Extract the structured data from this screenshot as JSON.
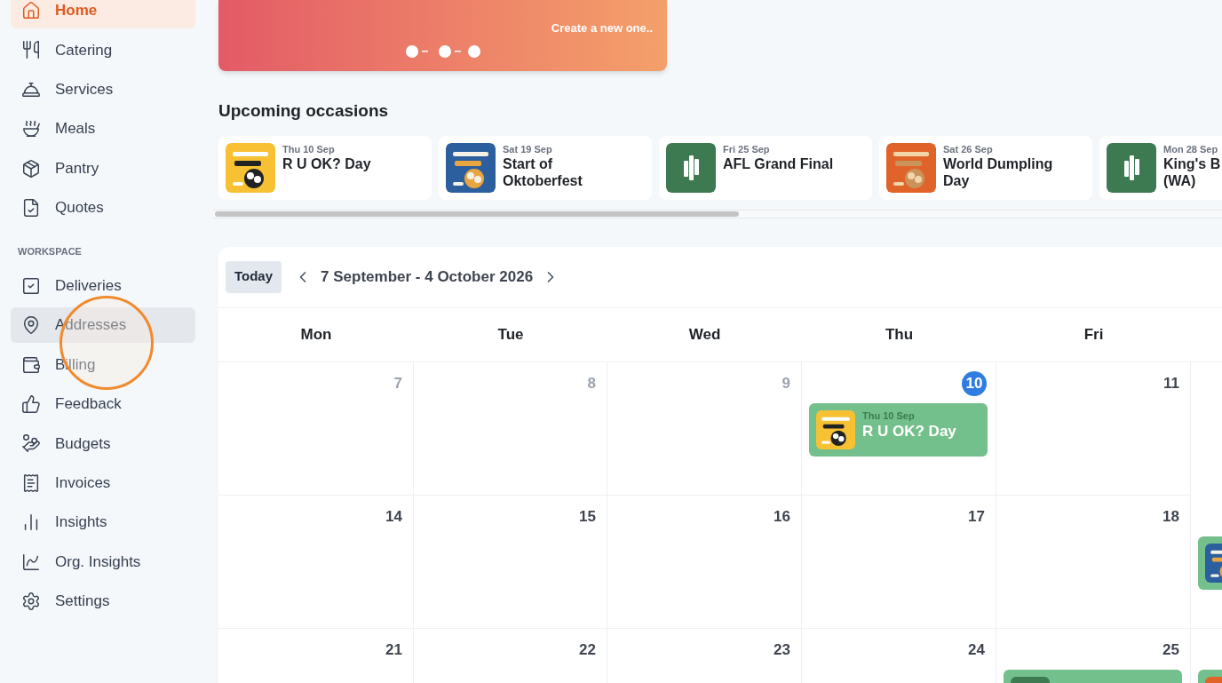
{
  "sidebar": {
    "sections": [
      {
        "items": [
          {
            "label": "Home",
            "selected": true,
            "hovered": false
          },
          {
            "label": "Catering",
            "selected": false,
            "hovered": false
          },
          {
            "label": "Services",
            "selected": false,
            "hovered": false
          },
          {
            "label": "Meals",
            "selected": false,
            "hovered": false
          },
          {
            "label": "Pantry",
            "selected": false,
            "hovered": false
          },
          {
            "label": "Quotes",
            "selected": false,
            "hovered": false
          }
        ]
      },
      {
        "heading": "WORKSPACE",
        "items": [
          {
            "label": "Deliveries",
            "selected": false,
            "hovered": false
          },
          {
            "label": "Addresses",
            "selected": false,
            "hovered": true
          },
          {
            "label": "Billing",
            "selected": false,
            "hovered": false
          },
          {
            "label": "Feedback",
            "selected": false,
            "hovered": false
          },
          {
            "label": "Budgets",
            "selected": false,
            "hovered": false
          },
          {
            "label": "Invoices",
            "selected": false,
            "hovered": false
          },
          {
            "label": "Insights",
            "selected": false,
            "hovered": false
          },
          {
            "label": "Org. Insights",
            "selected": false,
            "hovered": false
          },
          {
            "label": "Settings",
            "selected": false,
            "hovered": false
          }
        ]
      }
    ]
  },
  "banner": {
    "link": "Create a new one.."
  },
  "occasions": {
    "title": "Upcoming occasions",
    "items": [
      {
        "date": "Thu 10 Sep",
        "title": "R U OK? Day",
        "kind": "picture"
      },
      {
        "date": "Sat 19 Sep",
        "title": "Start of Oktoberfest",
        "kind": "picture"
      },
      {
        "date": "Fri 25 Sep",
        "title": "AFL Grand Final",
        "kind": "logo"
      },
      {
        "date": "Sat 26 Sep",
        "title": "World Dumpling Day",
        "kind": "picture"
      },
      {
        "date": "Mon 28 Sep",
        "title": "King's B\n(WA)",
        "kind": "logo"
      }
    ]
  },
  "calendar": {
    "today_button": "Today",
    "range": "7 September - 4 October 2026",
    "weekdays": [
      "Mon",
      "Tue",
      "Wed",
      "Thu",
      "Fri"
    ],
    "weeks": [
      [
        {
          "day": "7",
          "past": true,
          "today": false
        },
        {
          "day": "8",
          "past": true,
          "today": false
        },
        {
          "day": "9",
          "past": true,
          "today": false
        },
        {
          "day": "10",
          "past": false,
          "today": true,
          "events": [
            {
              "date": "Thu 10 Sep",
              "title": "R U OK? Day",
              "kind": "picture"
            }
          ]
        },
        {
          "day": "11",
          "past": false,
          "today": false
        }
      ],
      [
        {
          "day": "14",
          "past": false,
          "today": false
        },
        {
          "day": "15",
          "past": false,
          "today": false
        },
        {
          "day": "16",
          "past": false,
          "today": false
        },
        {
          "day": "17",
          "past": false,
          "today": false
        },
        {
          "day": "18",
          "past": false,
          "today": false
        },
        {
          "events": [
            {
              "kind": "picture"
            }
          ]
        }
      ],
      [
        {
          "day": "21",
          "past": false,
          "today": false
        },
        {
          "day": "22",
          "past": false,
          "today": false
        },
        {
          "day": "23",
          "past": false,
          "today": false
        },
        {
          "day": "24",
          "past": false,
          "today": false
        },
        {
          "day": "25",
          "past": false,
          "today": false,
          "events": [
            {
              "kind": "logo"
            }
          ]
        },
        {
          "events": [
            {
              "kind": "picture"
            }
          ]
        }
      ]
    ]
  }
}
